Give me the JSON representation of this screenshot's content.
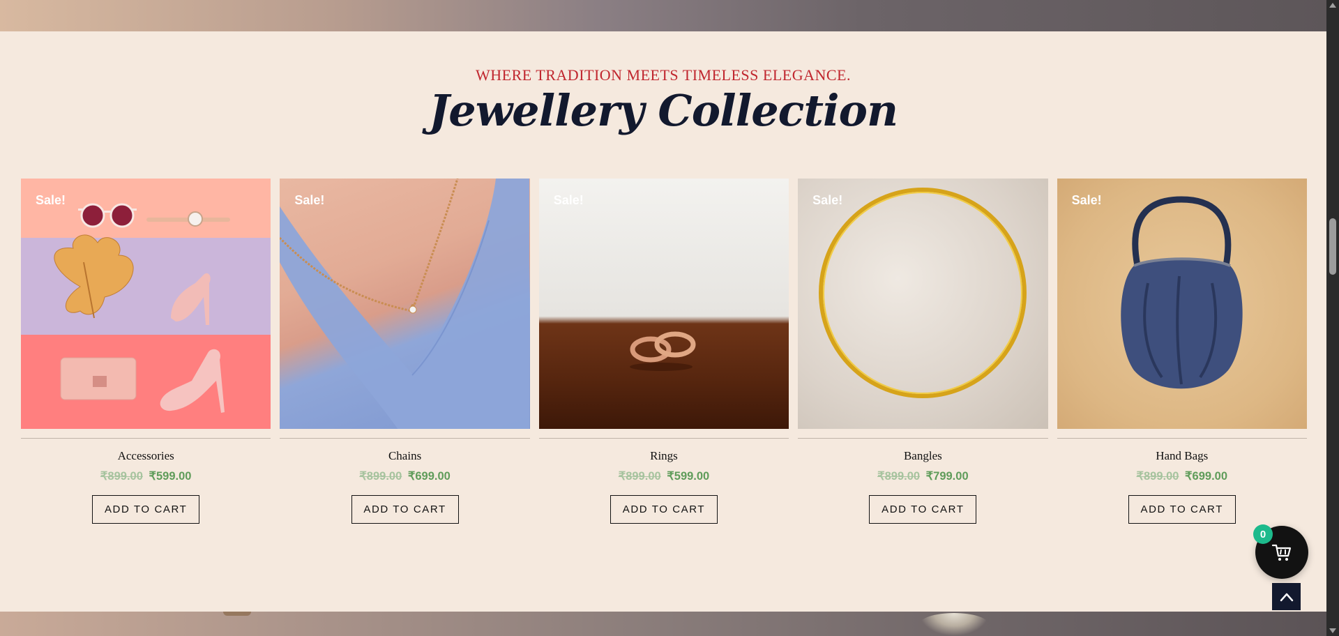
{
  "section": {
    "eyebrow": "WHERE TRADITION MEETS TIMELESS ELEGANCE.",
    "title": "Jewellery Collection"
  },
  "products": [
    {
      "name": "Accessories",
      "badge": "Sale!",
      "old_price": "₹899.00",
      "new_price": "₹599.00",
      "button": "ADD TO CART"
    },
    {
      "name": "Chains",
      "badge": "Sale!",
      "old_price": "₹899.00",
      "new_price": "₹699.00",
      "button": "ADD TO CART"
    },
    {
      "name": "Rings",
      "badge": "Sale!",
      "old_price": "₹899.00",
      "new_price": "₹599.00",
      "button": "ADD TO CART"
    },
    {
      "name": "Bangles",
      "badge": "Sale!",
      "old_price": "₹899.00",
      "new_price": "₹799.00",
      "button": "ADD TO CART"
    },
    {
      "name": "Hand Bags",
      "badge": "Sale!",
      "old_price": "₹899.00",
      "new_price": "₹699.00",
      "button": "ADD TO CART"
    }
  ],
  "cart": {
    "count": "0",
    "icon": "cart-icon"
  },
  "scroll_top": {
    "icon": "chevron-up-icon"
  },
  "colors": {
    "background": "#f5e9de",
    "eyebrow": "#c0262e",
    "title": "#12192e",
    "price_new": "#5f9c5a",
    "price_old": "#a6c39e",
    "cart_badge": "#1dba8c"
  }
}
